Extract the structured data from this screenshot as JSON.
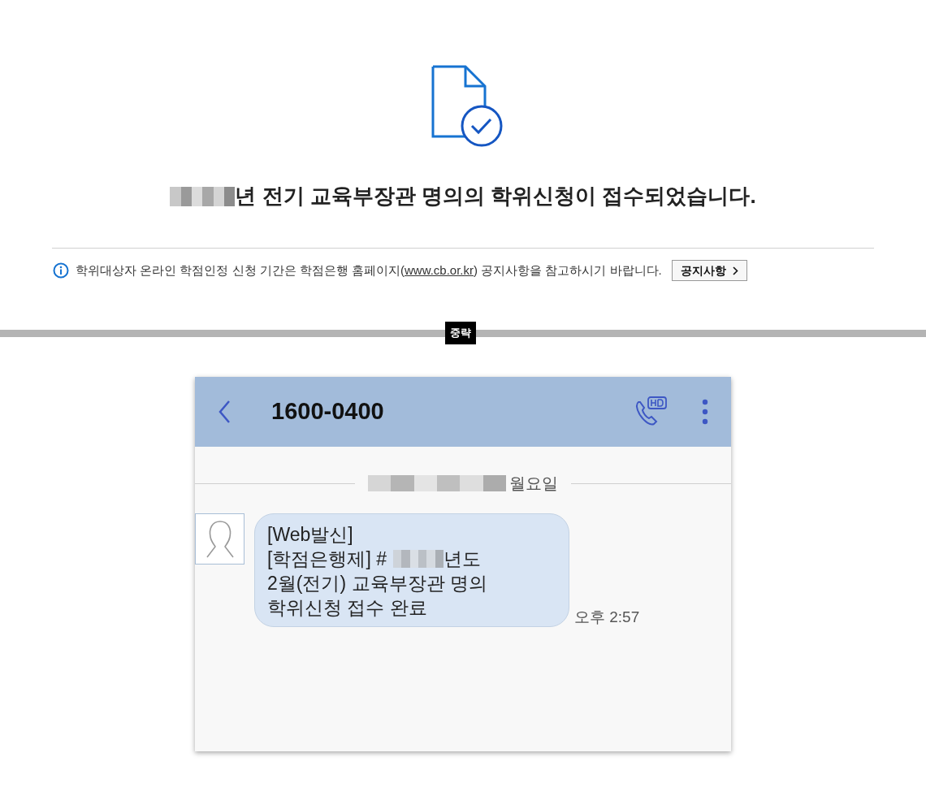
{
  "confirmation": {
    "heading": "년 전기 교육부장관 명의의 학위신청이 접수되었습니다.",
    "notice": {
      "before": "학위대상자 온라인 학점인정 신청 기간은 학점은행 홈페이지(",
      "link": "www.cb.or.kr",
      "after": ") 공지사항을 참고하시기 바랍니다."
    },
    "notice_button": "공지사항"
  },
  "separator_label": "중략",
  "phone": {
    "contact": "1600-0400",
    "date_divider": "월요일",
    "message": {
      "line_1": "[Web발신]",
      "line_2_start": "[학점은행제] #",
      "line_2_end": "년도",
      "line_3": "2월(전기) 교육부장관 명의",
      "line_4": "학위신청 접수 완료"
    },
    "time": "오후 2:57"
  }
}
